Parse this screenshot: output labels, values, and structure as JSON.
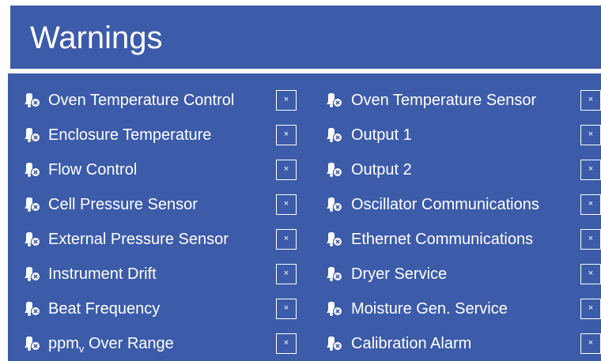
{
  "title": "Warnings",
  "clear_glyph": "×",
  "icon": "warning-bell-icon",
  "left": [
    {
      "label": "Oven Temperature Control"
    },
    {
      "label": "Enclosure Temperature"
    },
    {
      "label": "Flow Control"
    },
    {
      "label": "Cell Pressure Sensor"
    },
    {
      "label": "External Pressure Sensor"
    },
    {
      "label": "Instrument Drift"
    },
    {
      "label": "Beat Frequency"
    },
    {
      "label": "ppm",
      "sub": "v",
      "label_rest": " Over Range"
    }
  ],
  "right": [
    {
      "label": "Oven Temperature Sensor"
    },
    {
      "label": "Output 1"
    },
    {
      "label": "Output 2"
    },
    {
      "label": "Oscillator Communications"
    },
    {
      "label": "Ethernet Communications"
    },
    {
      "label": "Dryer Service"
    },
    {
      "label": "Moisture Gen. Service"
    },
    {
      "label": "Calibration Alarm"
    }
  ]
}
